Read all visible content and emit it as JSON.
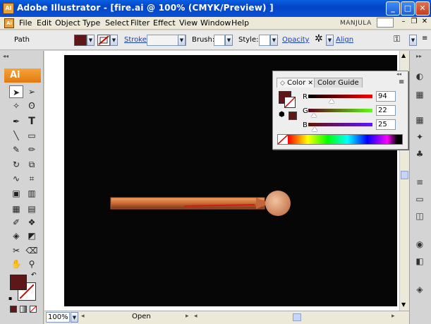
{
  "window": {
    "app_icon": "AI",
    "title": "Adobe Illustrator - [fire.ai @ 100% (CMYK/Preview) ]",
    "minimize_icon": "minimize-icon",
    "maximize_icon": "maximize-icon",
    "close_icon": "close-icon"
  },
  "menubar": {
    "items": [
      "File",
      "Edit",
      "Object",
      "Type",
      "Select",
      "Filter",
      "Effect",
      "View",
      "Window",
      "Help"
    ],
    "user": "MANJULA"
  },
  "control_panel": {
    "object_type": "Path",
    "fill_color": "#5e1619",
    "stroke_label": "Stroke:",
    "brush_label": "Brush:",
    "style_label": "Style:",
    "opacity_label": "Opacity",
    "align_label": "Align"
  },
  "tools_panel": {
    "badge": "Ai",
    "fill_color": "#5e1619"
  },
  "color_panel": {
    "tabs": [
      "Color",
      "Color Guide"
    ],
    "active_tab": "Color",
    "channels": [
      {
        "label": "R",
        "value": "94",
        "fraction": 0.369
      },
      {
        "label": "G",
        "value": "22",
        "fraction": 0.086
      },
      {
        "label": "B",
        "value": "25",
        "fraction": 0.098
      }
    ],
    "swatch_color": "#5e1619"
  },
  "statusbar": {
    "zoom": "100%",
    "status": "Open"
  }
}
